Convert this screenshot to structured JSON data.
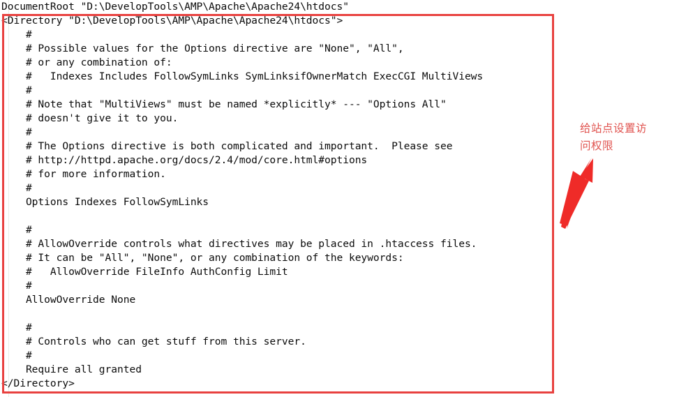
{
  "document": {
    "type": "apache-httpd-conf-snippet",
    "font_family_hint": "monospace",
    "lines": [
      "DocumentRoot \"D:\\DevelopTools\\AMP\\Apache\\Apache24\\htdocs\"",
      "<Directory \"D:\\DevelopTools\\AMP\\Apache\\Apache24\\htdocs\">",
      "    #",
      "    # Possible values for the Options directive are \"None\", \"All\",",
      "    # or any combination of:",
      "    #   Indexes Includes FollowSymLinks SymLinksifOwnerMatch ExecCGI MultiViews",
      "    #",
      "    # Note that \"MultiViews\" must be named *explicitly* --- \"Options All\"",
      "    # doesn't give it to you.",
      "    #",
      "    # The Options directive is both complicated and important.  Please see",
      "    # http://httpd.apache.org/docs/2.4/mod/core.html#options",
      "    # for more information.",
      "    #",
      "    Options Indexes FollowSymLinks",
      "",
      "    #",
      "    # AllowOverride controls what directives may be placed in .htaccess files.",
      "    # It can be \"All\", \"None\", or any combination of the keywords:",
      "    #   AllowOverride FileInfo AuthConfig Limit",
      "    #",
      "    AllowOverride None",
      "",
      "    #",
      "    # Controls who can get stuff from this server.",
      "    #",
      "    Require all granted",
      "</Directory>"
    ]
  },
  "annotations": {
    "callout_text_line_1": "给站点设置访",
    "callout_text_line_2": "问权限",
    "callout_text_full": "给站点设置访问权限",
    "arrow": {
      "label": "points-to-directory-block",
      "direction": "up-right"
    }
  },
  "colors": {
    "highlight_box_border": "#e8413f",
    "arrow_fill": "#ef2b28",
    "callout_text": "#e0534f",
    "code_text": "#0b0b0b",
    "page_background": "#ffffff",
    "gutter_rule": "#e8efe6"
  }
}
